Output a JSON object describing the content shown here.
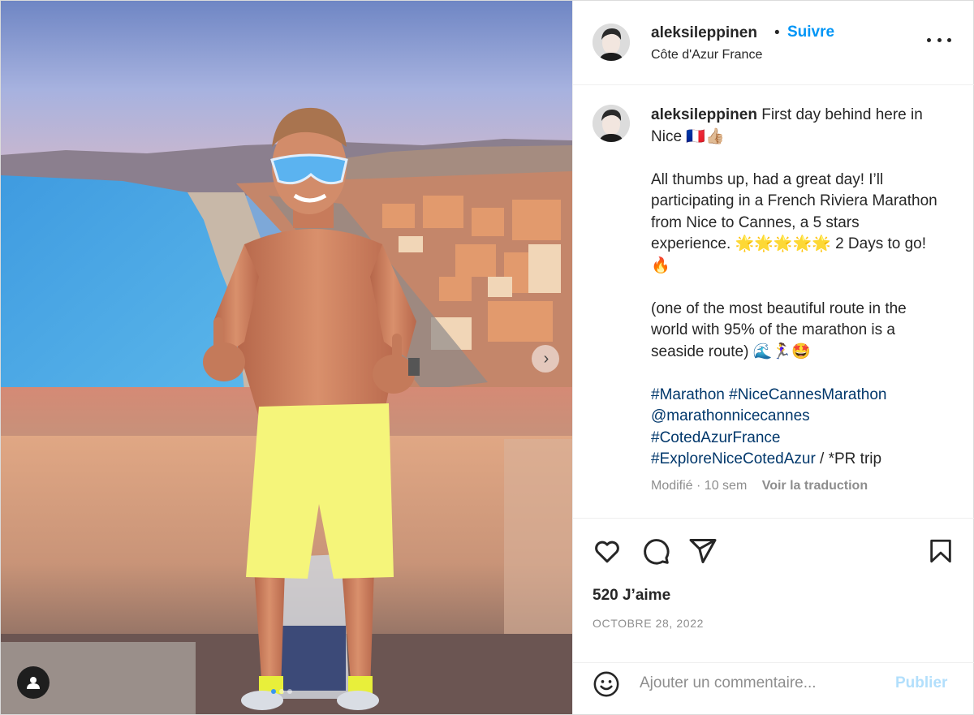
{
  "post": {
    "image_alt": "",
    "carousel_next_glyph": "›",
    "carousel_dots": 3,
    "carousel_active": 0
  },
  "header": {
    "username": "aleksileppinen",
    "separator": "•",
    "follow_label": "Suivre",
    "location": "Côte d'Azur France",
    "more_icon": "more-horizontal-icon"
  },
  "caption": {
    "username": "aleksileppinen",
    "line1": "First day behind here in Nice 🇫🇷👍🏼",
    "para2": "All thumbs up, had a great day! I’ll participating in a French Riviera Marathon from Nice to Cannes, a 5 stars experience. 🌟🌟🌟🌟🌟 2 Days to go! 🔥",
    "para3": "(one of the most beautiful route in the world with 95% of the marathon is a seaside route) 🌊🏃‍♀️🤩",
    "hashtags": {
      "h1": "#Marathon",
      "h2": "#NiceCannesMarathon",
      "mention": "@marathonnicecannes",
      "h3": "#CotedAzurFrance",
      "h4": "#ExploreNiceCotedAzur",
      "suffix": " / *PR trip"
    },
    "edited": "Modifié · 10 sem",
    "translate_label": "Voir la traduction"
  },
  "actions": {
    "likes": "520 J’aime",
    "date": "OCTOBRE 28, 2022"
  },
  "comment": {
    "placeholder": "Ajouter un commentaire...",
    "publish_label": "Publier"
  },
  "colors": {
    "link_blue": "#0095f6",
    "hashtag_blue": "#00376b",
    "muted_gray": "#8e8e8e",
    "publish_disabled": "#b2dffc"
  }
}
